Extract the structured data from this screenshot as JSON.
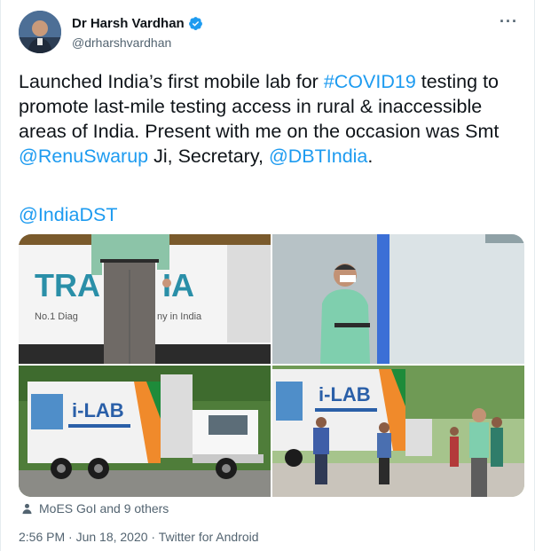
{
  "author": {
    "name": "Dr Harsh Vardhan",
    "handle": "@drharshvardhan",
    "verified": true
  },
  "tweet": {
    "part1": "Launched India’s first mobile lab for ",
    "hashtag": "#COVID19",
    "part2": " testing to promote last-mile testing access in rural & inaccessible areas of India. Present with me on the occasion was Smt ",
    "mention1": "@RenuSwarup",
    "part3": " Ji, Secretary, ",
    "mention2": "@DBTIndia",
    "part4": ".",
    "mention3": "@IndiaDST"
  },
  "media": {
    "photo1": {
      "brand": "TRANSASIA",
      "sub": "No.1 Diag",
      "sub2": "ny in India"
    },
    "photo3": {
      "logo": "i-LAB"
    },
    "photo4": {
      "logo": "i-LAB"
    }
  },
  "social_context": "MoES GoI and 9 others",
  "timestamp": "2:56 PM · Jun 18, 2020 · Twitter for Android",
  "colors": {
    "link": "#1d9bf0",
    "text": "#0f1419",
    "muted": "#536471"
  }
}
